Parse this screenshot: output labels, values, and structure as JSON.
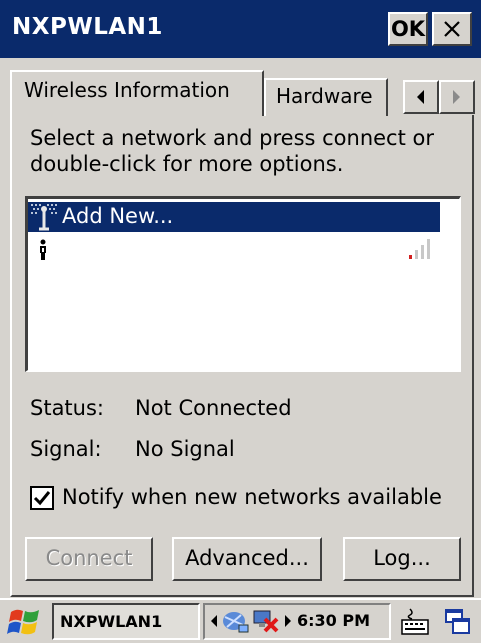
{
  "window": {
    "title": "NXPWLAN1",
    "ok_label": "OK",
    "close_label": "✕"
  },
  "tabs": [
    {
      "label": "Wireless Information",
      "active": true
    },
    {
      "label": "Hardware",
      "active": false
    }
  ],
  "instructions": "Select a network and press connect or double-click for more options.",
  "network_list": {
    "items": [
      {
        "label": "Add New...",
        "selected": true,
        "icon": "antenna-icon"
      },
      {
        "label": "",
        "selected": false,
        "icon": "network-person-icon",
        "signal_icon": "signal-strength-icon"
      }
    ]
  },
  "status": {
    "status_label": "Status:",
    "status_value": "Not Connected",
    "signal_label": "Signal:",
    "signal_value": "No Signal"
  },
  "notify": {
    "label": "Notify when new networks available",
    "checked": true
  },
  "buttons": {
    "connect": "Connect",
    "advanced": "Advanced...",
    "log": "Log..."
  },
  "taskbar": {
    "start_icon": "windows-flag-icon",
    "task_label": "NXPWLAN1",
    "time": "6:30 PM",
    "tray_icons": [
      "network-icon",
      "disconnected-icon",
      "keyboard-icon",
      "desktop-icon"
    ]
  },
  "colors": {
    "titlebar": "#0a2a6b",
    "selection": "#0a2a6b",
    "face": "#d6d3ce"
  }
}
